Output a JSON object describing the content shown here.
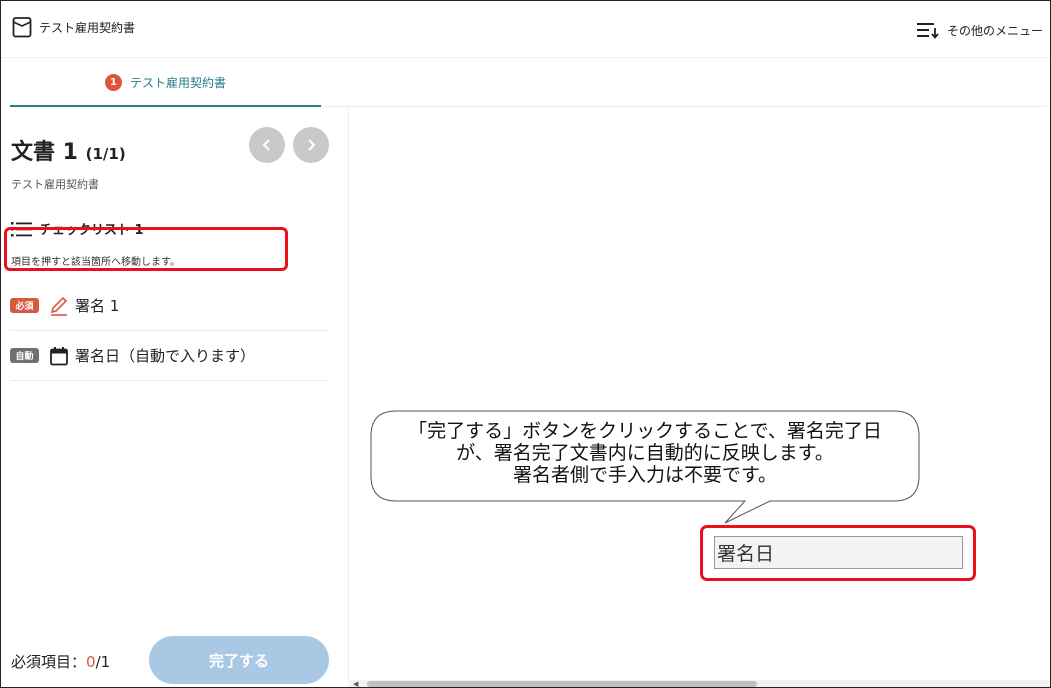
{
  "header": {
    "app_title": "テスト雇用契約書",
    "menu_label": "その他のメニュー",
    "menu_icon": "sort-down-icon",
    "app_icon": "document-box-icon"
  },
  "tab": {
    "number": "1",
    "label": "テスト雇用契約書",
    "accent_color": "#2a7f8c",
    "number_color": "#e0553a"
  },
  "sidebar": {
    "doc_title": "文書 1",
    "doc_count": "(1/1)",
    "doc_subtitle": "テスト雇用契約書",
    "checklist_title": "チェックリスト 1",
    "checklist_note": "項目を押すと該当箇所へ移動します。",
    "items": [
      {
        "badge": "必須",
        "icon": "pencil-icon",
        "label": "署名 1",
        "badge_color": "#d55a43"
      },
      {
        "badge": "自動",
        "icon": "calendar-icon",
        "label": "署名日（自動で入ります）",
        "badge_color": "#6f7073"
      }
    ],
    "required_label": "必須項目：",
    "required_done": "0",
    "required_total": "/1",
    "complete_button": "完了する"
  },
  "callout": {
    "lines": [
      "「完了する」ボタンをクリックすることで、署名完了日",
      "が、署名完了文書内に自動的に反映します。",
      "署名者側で手入力は不要です。"
    ]
  },
  "document": {
    "date_field_value": "署名日"
  },
  "highlight_color": "#e8101c"
}
